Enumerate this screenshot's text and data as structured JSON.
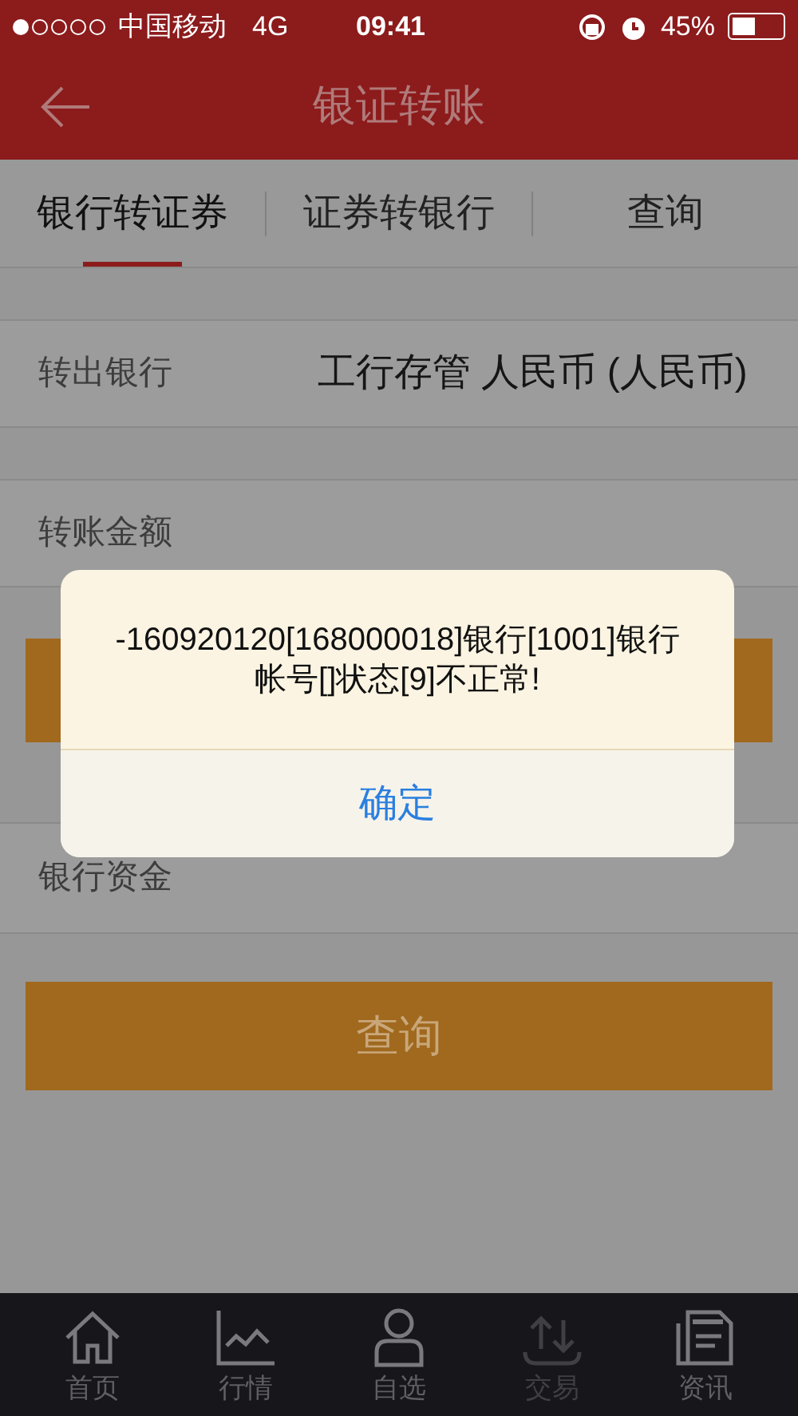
{
  "status_bar": {
    "carrier": "中国移动",
    "network": "4G",
    "time": "09:41",
    "battery": "45%"
  },
  "header": {
    "title": "银证转账"
  },
  "tabs": [
    {
      "label": "银行转证券",
      "selected": true
    },
    {
      "label": "证券转银行",
      "selected": false
    },
    {
      "label": "查询",
      "selected": false
    }
  ],
  "form": [
    {
      "label": "转出银行",
      "value": "工行存管 人民币 (人民币)"
    },
    {
      "label": "转账金额"
    }
  ],
  "balance_row": {
    "label": "银行资金"
  },
  "query_button": {
    "label": "查询"
  },
  "dialog": {
    "message": "-160920120[168000018]银行[1001]银行帐号[]状态[9]不正常!",
    "button": "确定"
  },
  "tab_bar": [
    {
      "label": "首页",
      "kind": "home",
      "disabled": false
    },
    {
      "label": "行情",
      "kind": "chart",
      "disabled": false
    },
    {
      "label": "自选",
      "kind": "person",
      "disabled": false
    },
    {
      "label": "交易",
      "kind": "trade",
      "disabled": true
    },
    {
      "label": "资讯",
      "kind": "news",
      "disabled": false
    }
  ]
}
